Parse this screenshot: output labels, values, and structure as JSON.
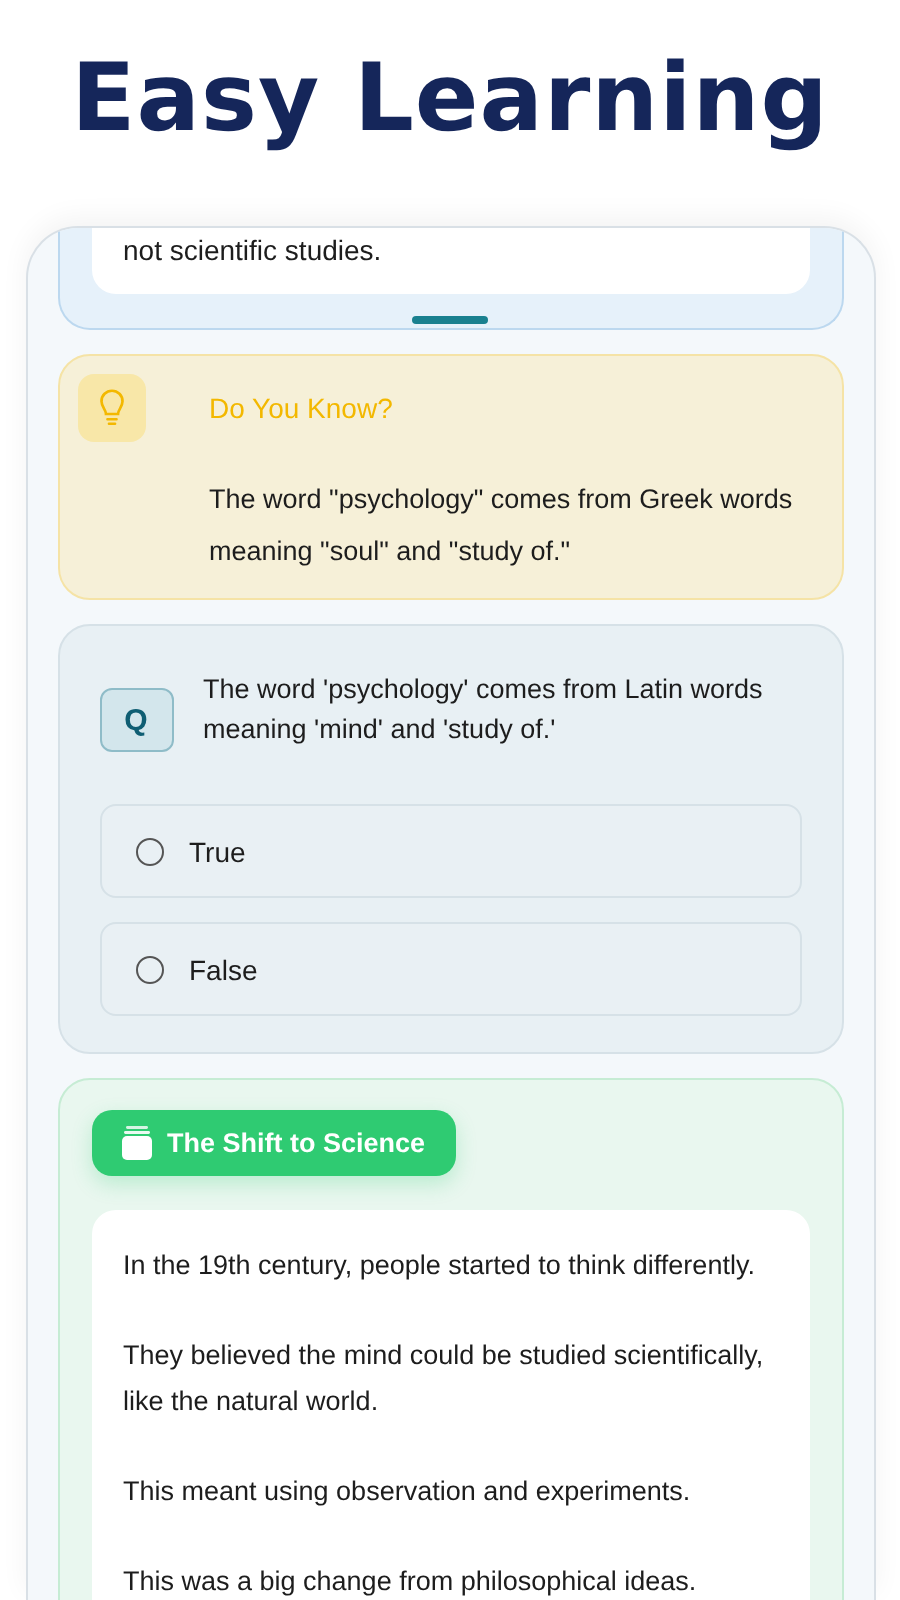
{
  "headline": "Easy Learning",
  "previous_card": {
    "text": "not scientific studies."
  },
  "fact": {
    "title": "Do You Know?",
    "text": "The word \"psychology\" comes from Greek words meaning \"soul\" and \"study of.\""
  },
  "quiz": {
    "badge": "Q",
    "question": "The word 'psychology' comes from Latin words meaning 'mind' and 'study of.'",
    "options": [
      {
        "label": "True",
        "selected": false
      },
      {
        "label": "False",
        "selected": false
      }
    ]
  },
  "section": {
    "title": "The Shift to Science",
    "paragraphs": [
      "In the 19th century, people started to think differently.",
      "They believed the mind could be studied scientifically, like the natural world.",
      "This meant using observation and experiments.",
      "This was a big change from philosophical ideas."
    ]
  }
}
